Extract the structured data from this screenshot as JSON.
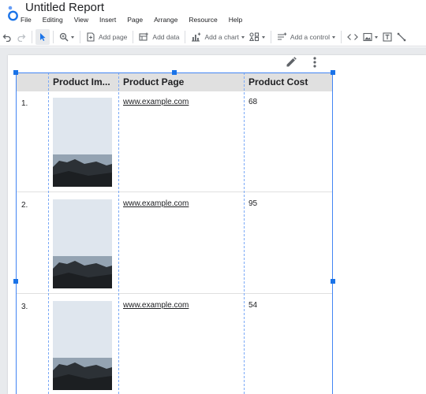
{
  "app": {
    "title": "Untitled Report",
    "logo_icon": "looker-studio-logo-icon",
    "menu": [
      "File",
      "Editing",
      "View",
      "Insert",
      "Page",
      "Arrange",
      "Resource",
      "Help"
    ]
  },
  "toolbar": {
    "add_page": "Add page",
    "add_data": "Add data",
    "add_chart": "Add a chart",
    "add_control": "Add a control"
  },
  "table": {
    "columns": [
      "",
      "Product Im...",
      "Product Page",
      "Product Cost"
    ],
    "rows": [
      {
        "num": "1.",
        "page": "www.example.com",
        "cost": "68"
      },
      {
        "num": "2.",
        "page": "www.example.com",
        "cost": "95"
      },
      {
        "num": "3.",
        "page": "www.example.com",
        "cost": "54"
      }
    ]
  },
  "colors": {
    "accent": "#1a73e8",
    "header_bg": "#e0e0e0",
    "canvas_bg": "#e8eaed"
  }
}
